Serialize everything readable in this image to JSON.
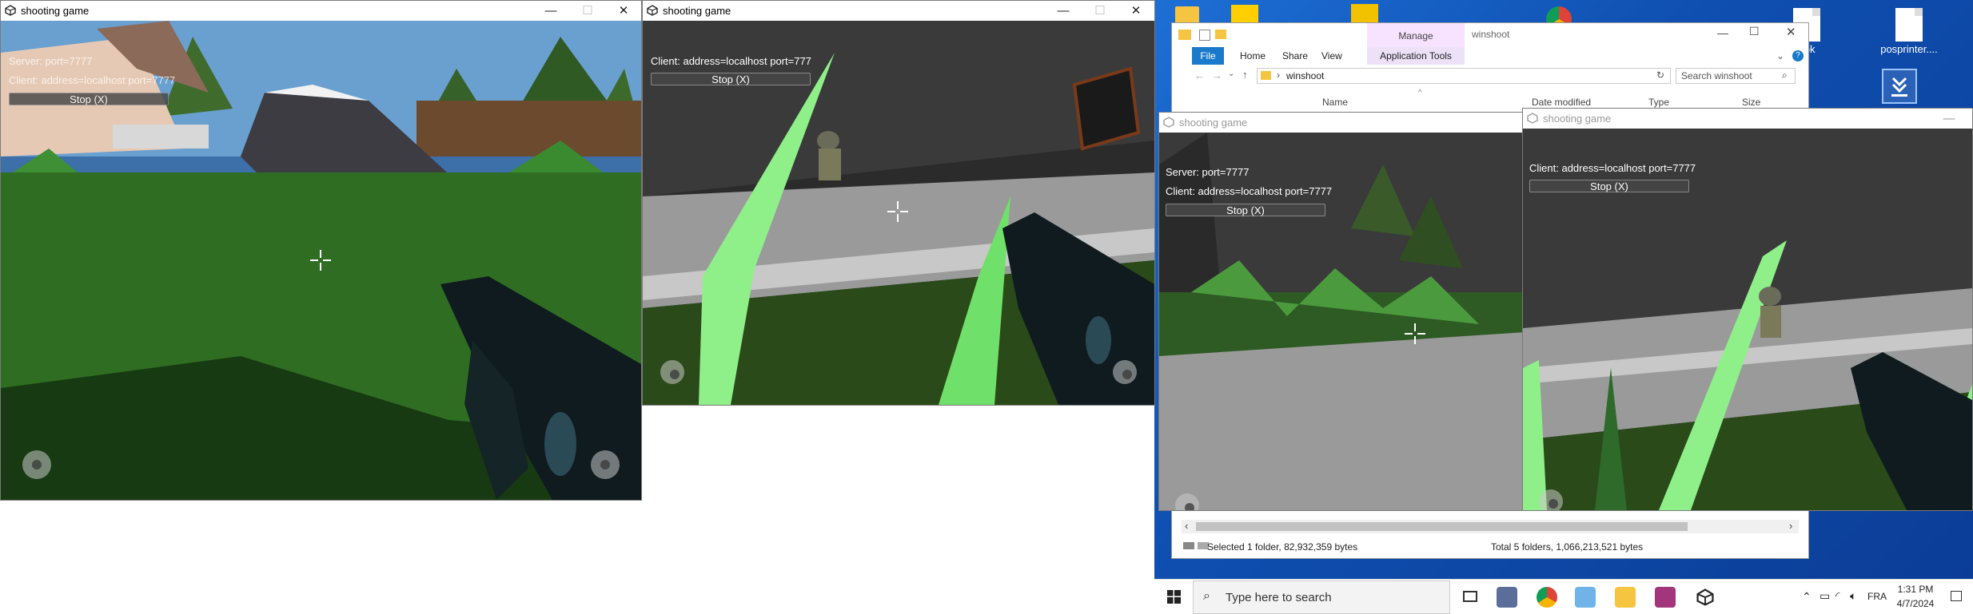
{
  "game_window_title": "shooting game",
  "hud": {
    "server": "Server: port=7777",
    "client": "Client: address=localhost port=7777",
    "client_clipped": "Client: address=localhost port=777",
    "stop": "Stop (X)"
  },
  "explorer": {
    "title": "winshoot",
    "manage": "Manage",
    "app_tools": "Application Tools",
    "tabs": [
      "File",
      "Home",
      "Share",
      "View"
    ],
    "path": "winshoot",
    "search_placeholder": "Search winshoot",
    "columns": [
      "Name",
      "Date modified",
      "Type",
      "Size"
    ],
    "status_left": "Selected 1 folder, 82,932,359 bytes",
    "status_right": "Total 5 folders, 1,066,213,521 bytes"
  },
  "desktop": {
    "icons": [
      {
        "label": "posprinter...."
      },
      {
        "label": "apk"
      }
    ]
  },
  "taskbar": {
    "search_placeholder": "Type here to search",
    "lang": "FRA",
    "time": "1:31 PM",
    "date": "4/7/2024"
  },
  "colors": {
    "grass": "#2f6e22",
    "grass_blade": "#8ff08a",
    "sky_dark": "#2b2b2b",
    "floor": "#9a9a9a",
    "desktop_blue": "#0f4fb0",
    "manage_pink": "#f7e2ff"
  }
}
